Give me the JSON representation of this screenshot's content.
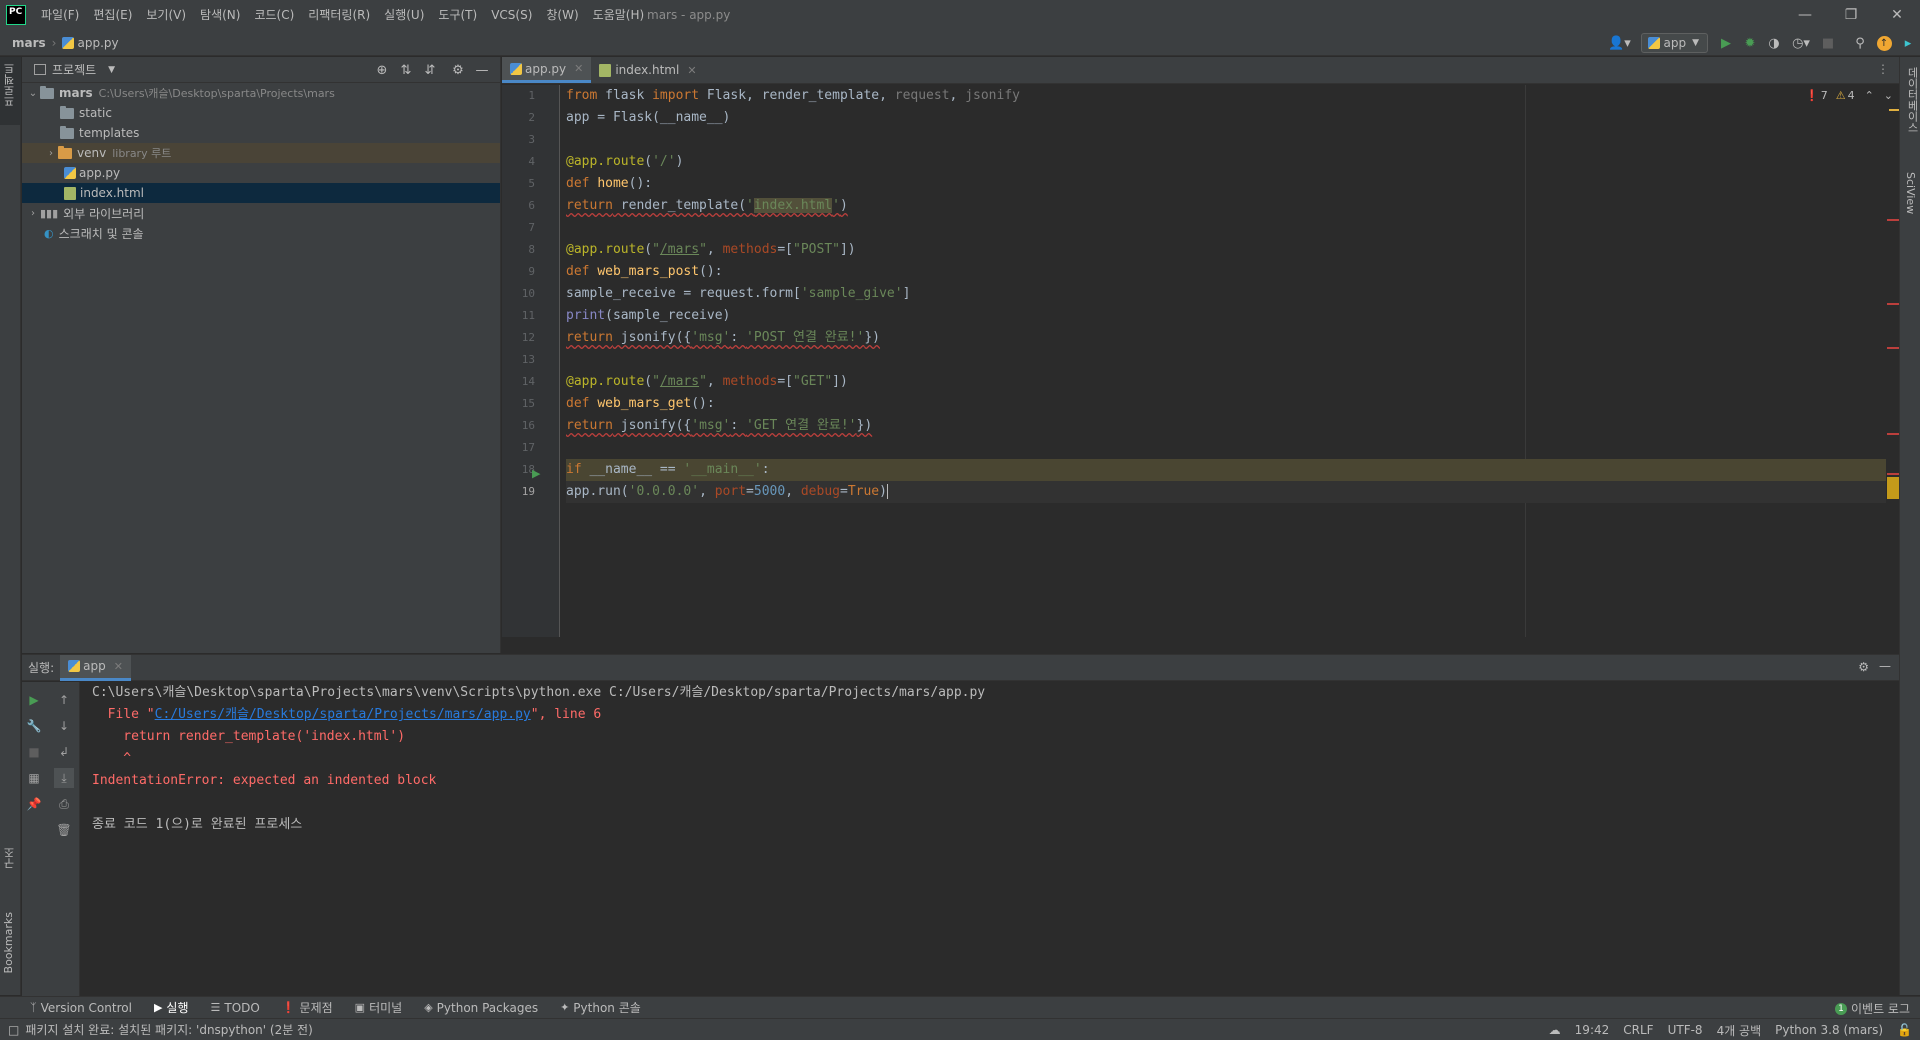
{
  "app": {
    "logo_text": "PC",
    "window_title": "mars - app.py"
  },
  "menu": [
    "파일(F)",
    "편집(E)",
    "보기(V)",
    "탐색(N)",
    "코드(C)",
    "리팩터링(R)",
    "실행(U)",
    "도구(T)",
    "VCS(S)",
    "창(W)",
    "도움말(H)"
  ],
  "nav": {
    "project": "mars",
    "file": "app.py",
    "run_config": "app"
  },
  "left_strip": {
    "project_tab": "프로젝트",
    "structure_tab": "구조",
    "bookmarks_tab": "Bookmarks"
  },
  "right_strip": {
    "database_tab": "데이터베이스",
    "sciview_tab": "SciView"
  },
  "project_panel": {
    "title": "프로젝트",
    "tree": [
      {
        "label": "mars",
        "path": "C:\\Users\\캐슬\\Desktop\\sparta\\Projects\\mars"
      },
      {
        "label": "static"
      },
      {
        "label": "templates"
      },
      {
        "label": "venv",
        "note": "library 루트"
      },
      {
        "label": "app.py"
      },
      {
        "label": "index.html"
      },
      {
        "label": "외부 라이브러리"
      },
      {
        "label": "스크래치 및 콘솔"
      }
    ]
  },
  "editor": {
    "tabs": [
      {
        "label": "app.py"
      },
      {
        "label": "index.html"
      }
    ],
    "inspection": {
      "errors": "7",
      "warnings": "4"
    },
    "line_numbers": [
      "1",
      "2",
      "3",
      "4",
      "5",
      "6",
      "7",
      "8",
      "9",
      "10",
      "11",
      "12",
      "13",
      "14",
      "15",
      "16",
      "17",
      "18",
      "19"
    ]
  },
  "run_panel": {
    "label": "실행:",
    "tab": "app",
    "output": [
      "C:\\Users\\캐슬\\Desktop\\sparta\\Projects\\mars\\venv\\Scripts\\python.exe C:/Users/캐슬/Desktop/sparta/Projects/mars/app.py",
      "  File \"",
      "C:/Users/캐슬/Desktop/sparta/Projects/mars/app.py",
      "\", line 6",
      "    return render_template('index.html')",
      "    ^",
      "IndentationError: expected an indented block",
      "종료 코드 1(으)로 완료된 프로세스"
    ]
  },
  "tool_windows": [
    "Version Control",
    "실행",
    "TODO",
    "문제점",
    "터미널",
    "Python Packages",
    "Python 콘솔"
  ],
  "event_log": "이벤트 로그",
  "status": {
    "message": "패키지 설치 완료: 설치된 패키지: 'dnspython' (2분 전)",
    "position": "19:42",
    "line_sep": "CRLF",
    "encoding": "UTF-8",
    "indent": "4개 공백",
    "interpreter": "Python 3.8 (mars)"
  },
  "colors": {
    "accent": "#4a88c7",
    "error": "#ff6b68",
    "bg": "#2b2b2b",
    "panel": "#3c3f41"
  }
}
